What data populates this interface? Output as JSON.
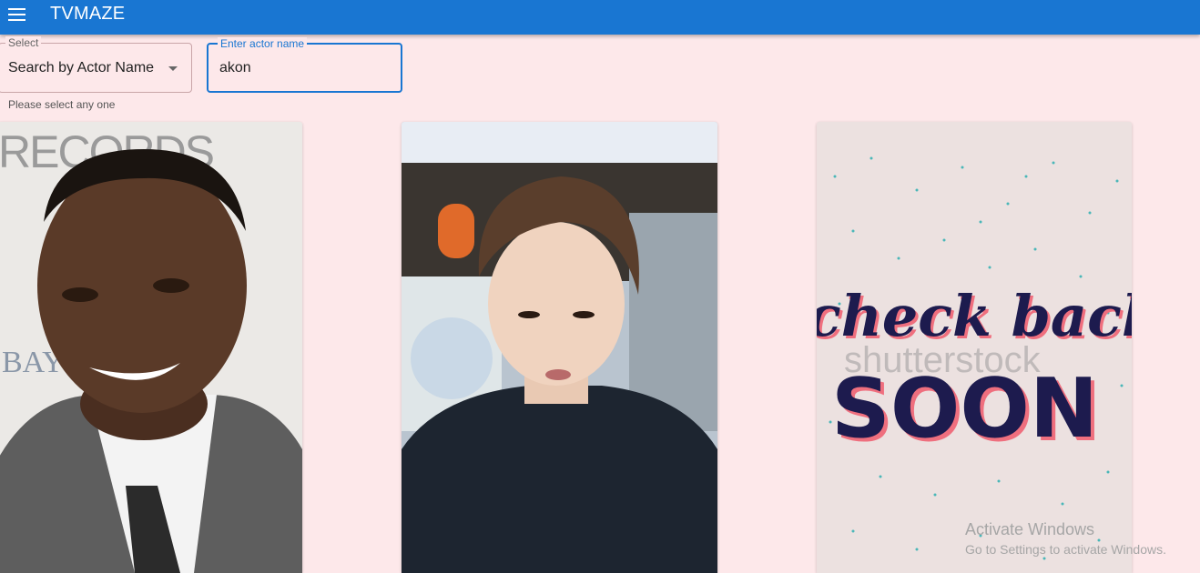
{
  "appbar": {
    "title": "TVMAZE",
    "menu_icon": "menu-icon",
    "color": "#1976d2"
  },
  "search": {
    "select_legend": "Select",
    "select_value": "Search by Actor Name",
    "select_helper": "Please select any one",
    "input_legend": "Enter actor name",
    "input_value": "akon"
  },
  "cards": [
    {
      "image": "actor-photo-akon",
      "photo_text": [
        "RECORDS",
        "BAY"
      ]
    },
    {
      "image": "actor-photo-young-man"
    },
    {
      "image": "placeholder-check-back-soon",
      "art_text": [
        "check back",
        "SOON"
      ],
      "stock_watermark": "shutterstock"
    }
  ],
  "os_watermark": {
    "line1": "Activate Windows",
    "line2": "Go to Settings to activate Windows."
  }
}
